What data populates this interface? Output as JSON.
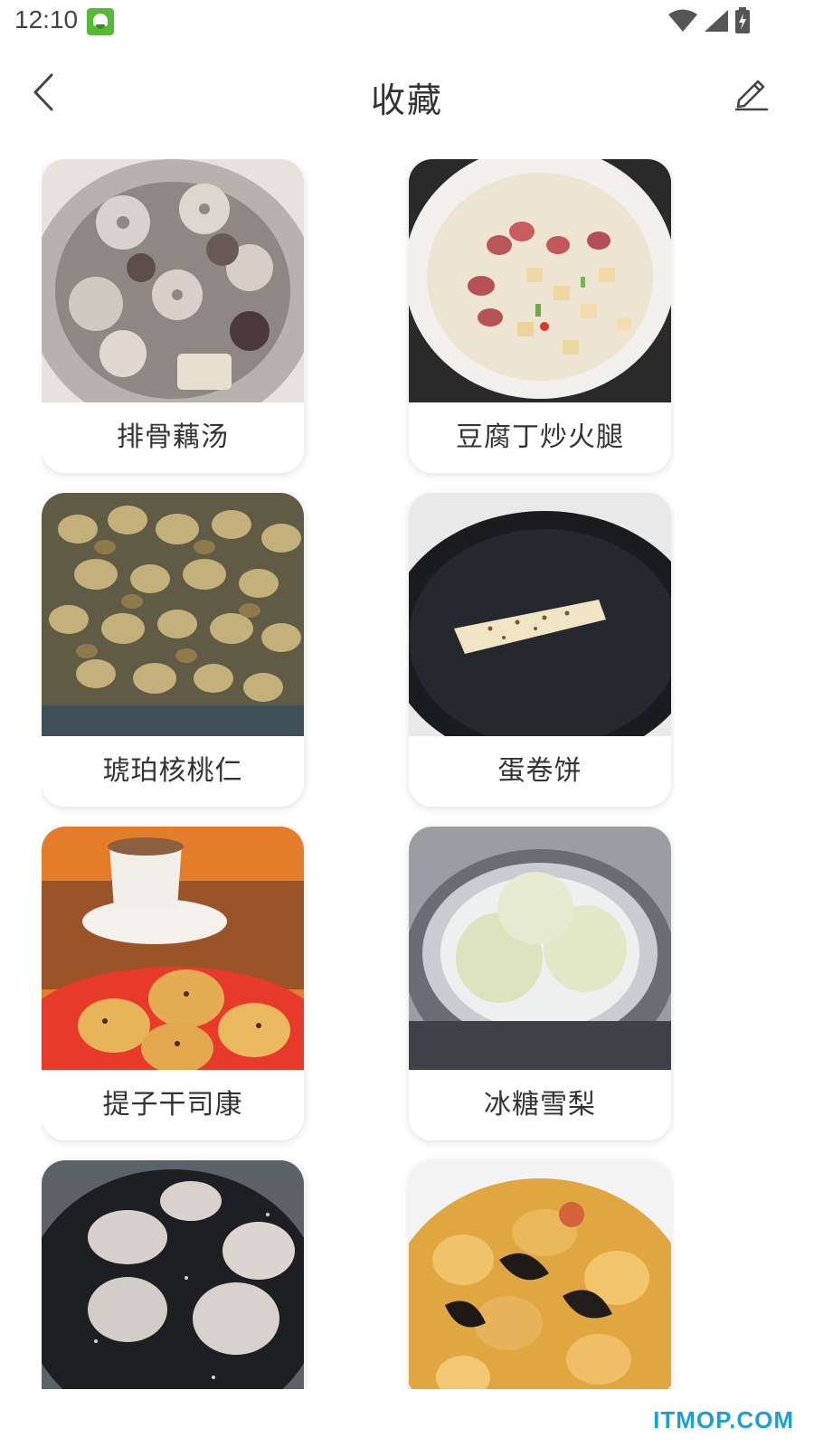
{
  "status_bar": {
    "time": "12:10",
    "icons": [
      "app-notification-icon",
      "wifi-icon",
      "signal-icon",
      "battery-charging-icon"
    ]
  },
  "header": {
    "title": "收藏",
    "back_icon": "chevron-left-icon",
    "edit_icon": "pencil-icon"
  },
  "favorites": [
    {
      "name": "排骨藕汤",
      "photo": "lotus-root-pork-rib-soup"
    },
    {
      "name": "豆腐丁炒火腿",
      "photo": "tofu-cubes-ham-stir-fry"
    },
    {
      "name": "琥珀核桃仁",
      "photo": "amber-walnuts"
    },
    {
      "name": "蛋卷饼",
      "photo": "egg-roll-pancake"
    },
    {
      "name": "提子干司康",
      "photo": "raisin-scones"
    },
    {
      "name": "冰糖雪梨",
      "photo": "rock-sugar-pear"
    },
    {
      "name": "",
      "photo": "pancakes-on-griddle"
    },
    {
      "name": "",
      "photo": "braised-dish-with-wood-ear"
    }
  ],
  "watermark": "ITMOP.COM",
  "colors": {
    "background": "#ffffff",
    "text": "#333333",
    "watermark": "#1aa0d8"
  }
}
